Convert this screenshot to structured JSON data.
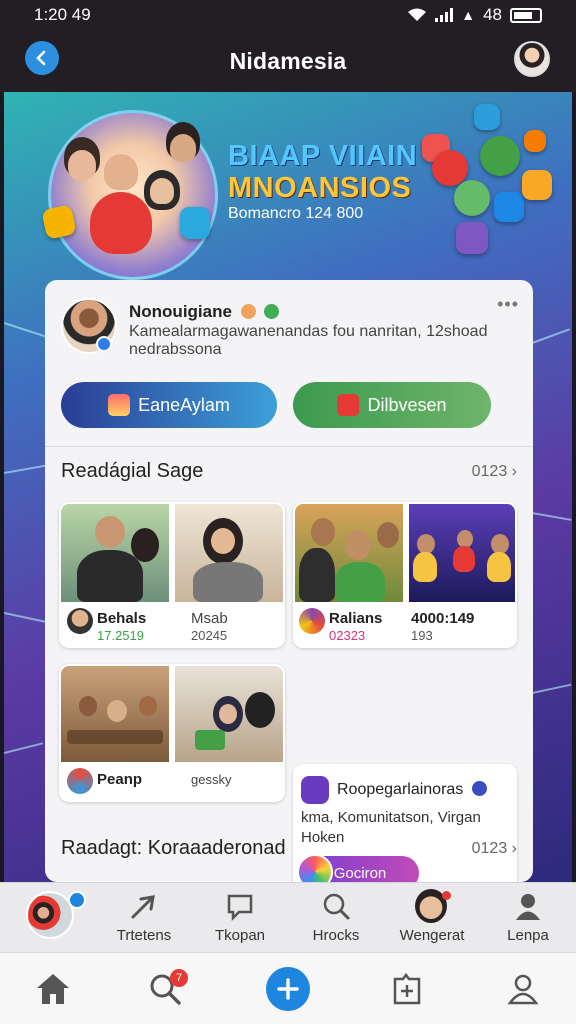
{
  "status_bar": {
    "time": "1:20 49",
    "battery_text": "48"
  },
  "header": {
    "title": "Nidamesia"
  },
  "hero": {
    "title_line1": "BIAAP VIIAIN",
    "title_line2": "MNOANSIOS",
    "subtitle": "Bomancro 124 800"
  },
  "profile": {
    "name": "Nonouigiane",
    "description": "Kamealarmagawanenandas fou nanritan, 12shoad nedrabssona",
    "more": "•••"
  },
  "actions": {
    "primary_label": "EaneAylam",
    "secondary_label": "Dilbvesen"
  },
  "section1": {
    "title": "Readágial Sage",
    "link": "0123 ›"
  },
  "tiles": [
    {
      "title": "Behals",
      "sub": "17.2519",
      "sub_color": "#3aa34a"
    },
    {
      "title": "Msab",
      "sub": "20245",
      "sub_color": "#555555"
    },
    {
      "title": "Ralians",
      "sub": "02323",
      "sub_color": "#d8327a"
    },
    {
      "title": "4000:149",
      "sub": "193",
      "sub_color": "#555555"
    }
  ],
  "row2": {
    "left_label": "Peanp",
    "right_label": "gessky"
  },
  "community": {
    "title": "Roopegarlainoras",
    "description": "kma, Komunitatson, Virgan Hoken",
    "button_label": "Gociron"
  },
  "section2": {
    "title": "Raadagt: Koraaaderonad",
    "link": "0123 ›"
  },
  "strip": [
    {
      "label": "",
      "icon": "group-avatar-icon"
    },
    {
      "label": "Trtetens",
      "icon": "arrow-icon"
    },
    {
      "label": "Tkopan",
      "icon": "message-icon"
    },
    {
      "label": "Hrocks",
      "icon": "search-icon"
    },
    {
      "label": "Wengerat",
      "icon": "avatar-icon"
    },
    {
      "label": "Lenpa",
      "icon": "person-icon"
    }
  ],
  "nav": {
    "notification_count": "7",
    "icons": [
      "home-icon",
      "search-icon",
      "plus-icon",
      "add-page-icon",
      "profile-icon"
    ]
  },
  "colors": {
    "accent_blue": "#1f86e0",
    "header_bg": "#221e24",
    "primary_pill": "#2a3d96",
    "secondary_pill": "#3b9a4f",
    "notification_red": "#e53935"
  }
}
